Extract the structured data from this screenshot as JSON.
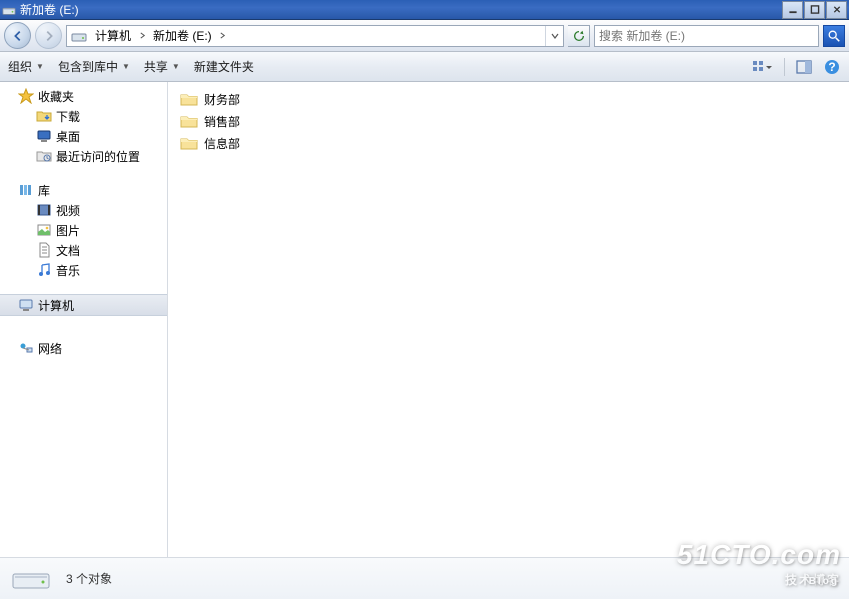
{
  "window": {
    "title": "新加卷 (E:)"
  },
  "breadcrumbs": {
    "root": "计算机",
    "current": "新加卷 (E:)"
  },
  "search": {
    "placeholder": "搜索 新加卷 (E:)"
  },
  "toolbar": {
    "organize": "组织",
    "include": "包含到库中",
    "share": "共享",
    "newfolder": "新建文件夹"
  },
  "sidebar": {
    "favorites": {
      "label": "收藏夹",
      "items": [
        "下载",
        "桌面",
        "最近访问的位置"
      ]
    },
    "libraries": {
      "label": "库",
      "items": [
        "视频",
        "图片",
        "文档",
        "音乐"
      ]
    },
    "computer": {
      "label": "计算机"
    },
    "network": {
      "label": "网络"
    }
  },
  "folders": [
    "财务部",
    "销售部",
    "信息部"
  ],
  "status": {
    "count_text": "3 个对象"
  },
  "watermark": {
    "line1": "51CTO.com",
    "line2": "技术博客",
    "blog": "Blog"
  }
}
